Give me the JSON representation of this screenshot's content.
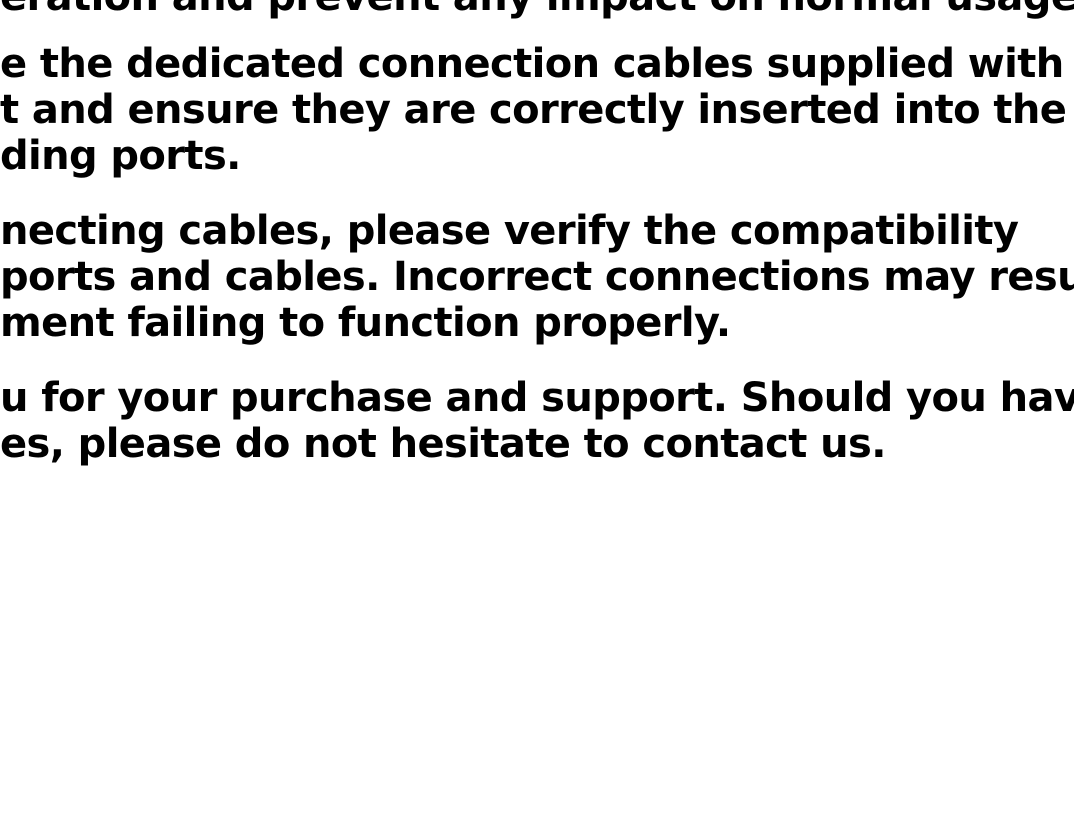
{
  "document": {
    "paragraphs": [
      {
        "lines": [
          "eration and prevent any impact on normal usage."
        ]
      },
      {
        "lines": [
          "e the dedicated connection cables supplied with th",
          "t and ensure they are correctly inserted into the",
          "ding ports."
        ]
      },
      {
        "lines": [
          "necting cables, please verify the compatibility",
          "ports and cables. Incorrect connections may result",
          "ment failing to function properly."
        ]
      },
      {
        "lines": [
          "u for your purchase and support. Should you have",
          "es, please do not hesitate to contact us."
        ]
      }
    ]
  }
}
